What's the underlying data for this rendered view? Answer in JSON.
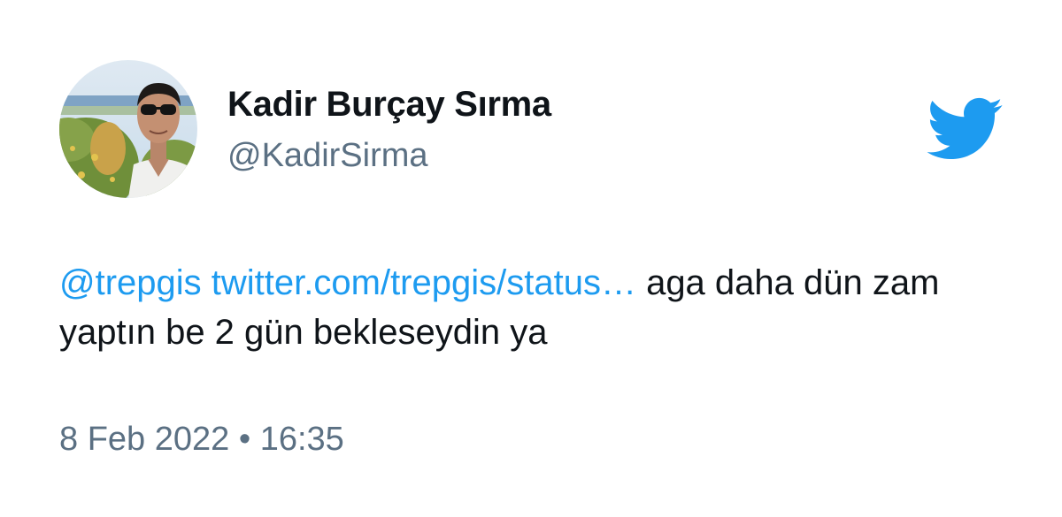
{
  "author": {
    "display_name": "Kadir Burçay Sırma",
    "handle": "@KadirSirma",
    "avatar_icon": "profile-photo"
  },
  "brand": {
    "icon": "twitter-bird-icon",
    "color": "#1d9bf0"
  },
  "tweet": {
    "mention": "@trepgis",
    "link": "twitter.com/trepgis/status…",
    "text": " aga daha dün zam yaptın be 2 gün bekleseydin ya"
  },
  "meta": {
    "date": "8 Feb 2022",
    "separator": "•",
    "time": "16:35"
  }
}
